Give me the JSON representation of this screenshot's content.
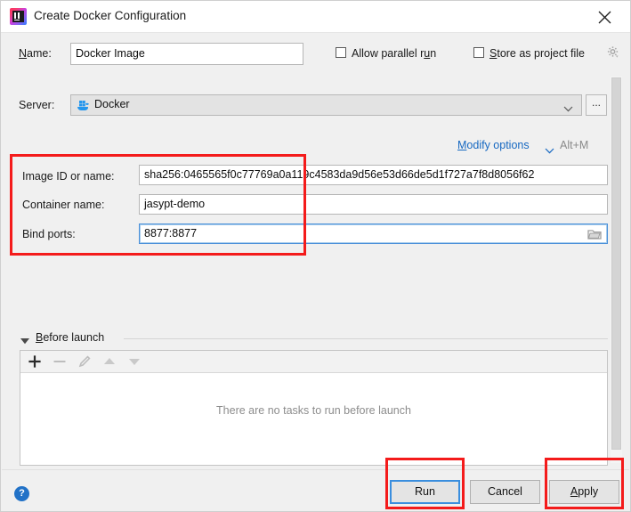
{
  "window": {
    "title": "Create Docker Configuration",
    "app_icon": "intellij-idea-logo",
    "close_label": "×"
  },
  "name_row": {
    "label": "Name:",
    "value": "Docker Image",
    "placeholder": ""
  },
  "options": {
    "allow_parallel_run": {
      "label": "Allow parallel run",
      "checked": false
    },
    "store_as_project_file": {
      "label": "Store as project file",
      "checked": false
    },
    "gear_icon": "gear-icon"
  },
  "server_row": {
    "label": "Server:",
    "value": "Docker",
    "icon": "docker-whale-icon",
    "chevron": "chevron-down-icon",
    "browse_label": "..."
  },
  "modify_options": {
    "link_first_char": "M",
    "link_rest": "odify options",
    "chevron": "chevron-down-icon",
    "shortcut": "Alt+M"
  },
  "fields": [
    {
      "label": "Image ID or name:",
      "value": "sha256:0465565f0c77769a0a119c4583da9d56e53d66de5d1f727a7f8d8056f62",
      "focused": false
    },
    {
      "label": "Container name:",
      "value": "jasypt-demo",
      "focused": false
    },
    {
      "label": "Bind ports:",
      "value": "8877:8877",
      "focused": true,
      "browse_icon": "folder-icon"
    }
  ],
  "before_launch": {
    "collapse_icon": "triangle-down-icon",
    "label_first_char": "B",
    "label_rest": "efore launch",
    "toolbar": [
      {
        "name": "add-task-button",
        "glyph": "+",
        "enabled": true
      },
      {
        "name": "remove-task-button",
        "glyph": "−",
        "enabled": false
      },
      {
        "name": "edit-task-button",
        "glyph": "pencil-icon",
        "enabled": false
      },
      {
        "name": "move-up-button",
        "glyph": "triangle-up-icon",
        "enabled": false
      },
      {
        "name": "move-down-button",
        "glyph": "triangle-down-icon",
        "enabled": false
      }
    ],
    "empty_message": "There are no tasks to run before launch"
  },
  "footer": {
    "help_glyph": "?",
    "buttons": {
      "run": "Run",
      "cancel": "Cancel",
      "apply_first_char": "A",
      "apply_rest": "pply"
    }
  },
  "annotations": {
    "color": "#f41b1b",
    "boxes": [
      "fields-group",
      "run-button",
      "apply-button"
    ]
  }
}
